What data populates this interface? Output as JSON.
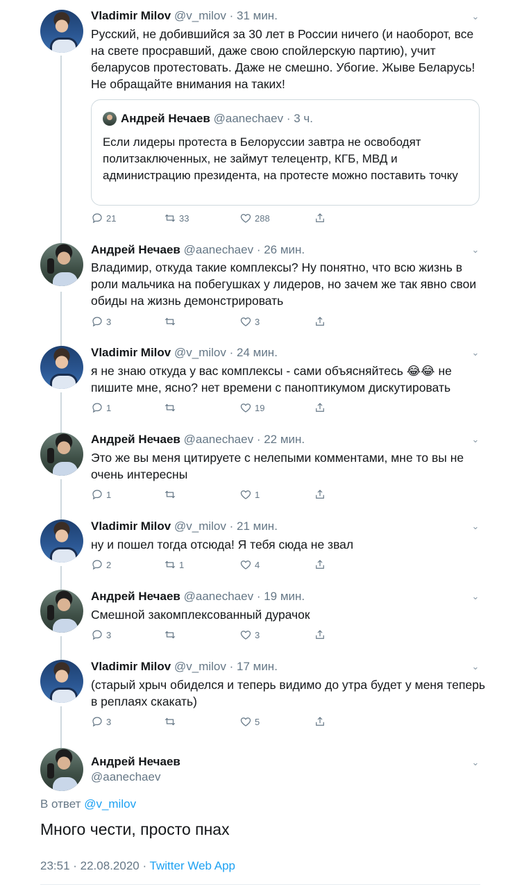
{
  "tweets": [
    {
      "name": "Vladimir Milov",
      "handle": "@v_milov",
      "time": "· 31 мин.",
      "text": "Русский, не добившийся за 30 лет в России ничего (и наоборот, все на свете просравший, даже свою спойлерскую партию), учит беларусов протестовать. Даже не смешно. Убогие. Жыве Беларусь! Не обращайте внимания на таких!",
      "quote": {
        "name": "Андрей Нечаев",
        "handle": "@aanechaev",
        "time": "· 3 ч.",
        "text": "Если лидеры протеста в Белоруссии завтра не освободят политзаключенных, не займут телецентр, КГБ, МВД и администрацию президента, на протесте можно поставить точку"
      },
      "replies": "21",
      "retweets": "33",
      "likes": "288"
    },
    {
      "name": "Андрей Нечаев",
      "handle": "@aanechaev",
      "time": "· 26 мин.",
      "text": "Владимир, откуда такие комплексы? Ну понятно, что всю жизнь в роли мальчика на побегушках у лидеров, но зачем же так явно свои обиды на жизнь демонстрировать",
      "replies": "3",
      "retweets": "",
      "likes": "3"
    },
    {
      "name": "Vladimir Milov",
      "handle": "@v_milov",
      "time": "· 24 мин.",
      "text": "я не знаю откуда у вас комплексы - сами объясняйтесь 😂😂 не пишите мне, ясно? нет времени с паноптикумом дискутировать",
      "replies": "1",
      "retweets": "",
      "likes": "19"
    },
    {
      "name": "Андрей Нечаев",
      "handle": "@aanechaev",
      "time": "· 22 мин.",
      "text": "Это же вы меня цитируете с нелепыми комментами, мне то вы не очень интересны",
      "replies": "1",
      "retweets": "",
      "likes": "1"
    },
    {
      "name": "Vladimir Milov",
      "handle": "@v_milov",
      "time": "· 21 мин.",
      "text": "ну и пошел тогда отсюда! Я тебя сюда не звал",
      "replies": "2",
      "retweets": "1",
      "likes": "4"
    },
    {
      "name": "Андрей Нечаев",
      "handle": "@aanechaev",
      "time": "· 19 мин.",
      "text": "Смешной закомплексованный дурачок",
      "replies": "3",
      "retweets": "",
      "likes": "3"
    },
    {
      "name": "Vladimir Milov",
      "handle": "@v_milov",
      "time": "· 17 мин.",
      "text": "(старый хрыч обиделся и теперь видимо до утра будет у меня теперь в реплаях скакать)",
      "replies": "3",
      "retweets": "",
      "likes": "5"
    }
  ],
  "main": {
    "name": "Андрей Нечаев",
    "handle": "@aanechaev",
    "reply_prefix": "В ответ",
    "reply_to": "@v_milov",
    "text": "Много чести, просто пнах",
    "datetime": "23:51 · 22.08.2020 ·",
    "app": "Twitter Web App"
  }
}
